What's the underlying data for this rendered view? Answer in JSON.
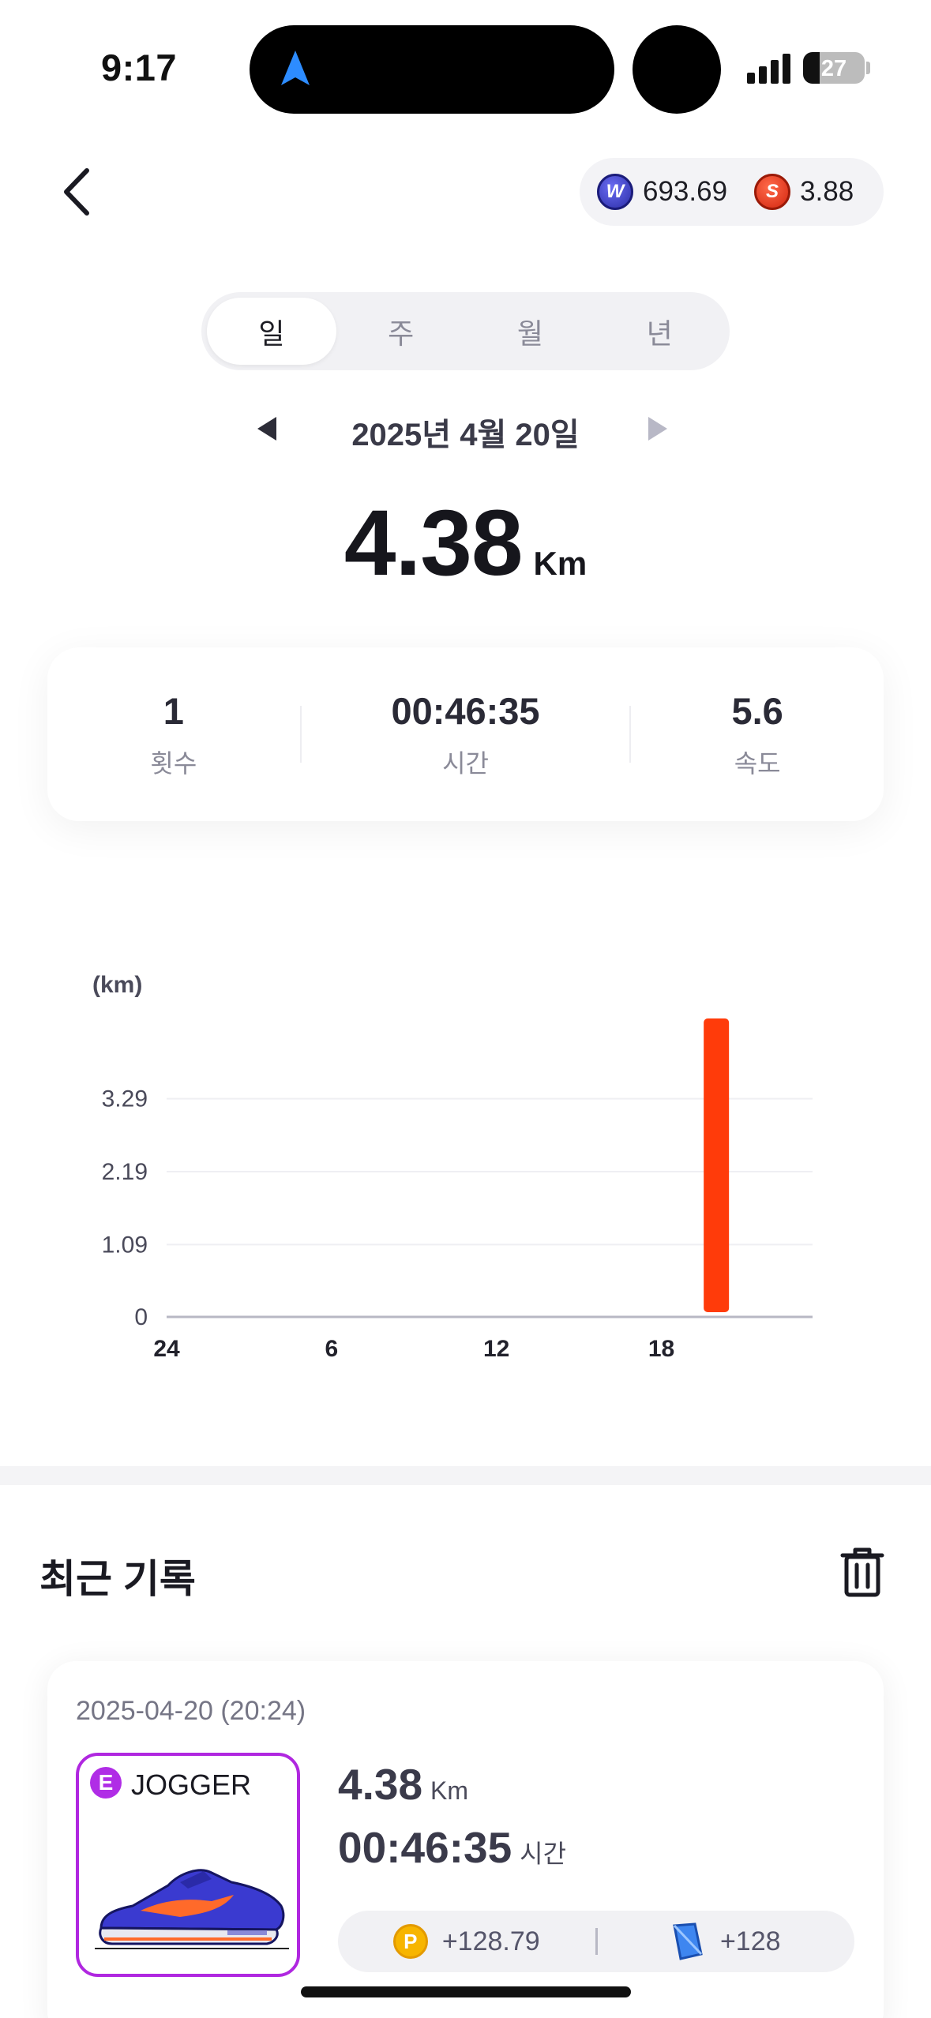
{
  "status_bar": {
    "time": "9:17",
    "battery": "27"
  },
  "header": {
    "balance_w": "693.69",
    "balance_s": "3.88",
    "coin_w_letter": "W",
    "coin_s_letter": "S"
  },
  "tabs": [
    {
      "label": "일",
      "active": true
    },
    {
      "label": "주",
      "active": false
    },
    {
      "label": "월",
      "active": false
    },
    {
      "label": "년",
      "active": false
    }
  ],
  "date": "2025년 4월 20일",
  "total_distance": {
    "value": "4.38",
    "unit": "Km"
  },
  "stats": [
    {
      "value": "1",
      "label": "횟수"
    },
    {
      "value": "00:46:35",
      "label": "시간"
    },
    {
      "value": "5.6",
      "label": "속도"
    }
  ],
  "chart_data": {
    "type": "bar",
    "ylabel": "(km)",
    "y_ticks": [
      "0",
      "1.09",
      "2.19",
      "3.29"
    ],
    "ylim": [
      0,
      4.38
    ],
    "x_ticks": [
      {
        "hour": 0,
        "label": "24"
      },
      {
        "hour": 6,
        "label": "6"
      },
      {
        "hour": 12,
        "label": "12"
      },
      {
        "hour": 18,
        "label": "18"
      }
    ],
    "xlim": [
      0,
      23.5
    ],
    "bars": [
      {
        "hour": 20,
        "value": 4.38
      }
    ],
    "bar_color": "#ff3b0a",
    "grid": true
  },
  "recent": {
    "title": "최근 기록",
    "record": {
      "datetime": "2025-04-20 (20:24)",
      "badge": "E",
      "shoe_name": "JOGGER",
      "distance": "4.38",
      "distance_unit": "Km",
      "time": "00:46:35",
      "time_unit": "시간",
      "reward_p_letter": "P",
      "reward_p": "+128.79",
      "reward_gem": "+128"
    }
  },
  "colors": {
    "accent": "#ff3b0a",
    "shoe_border": "#b027e0"
  }
}
